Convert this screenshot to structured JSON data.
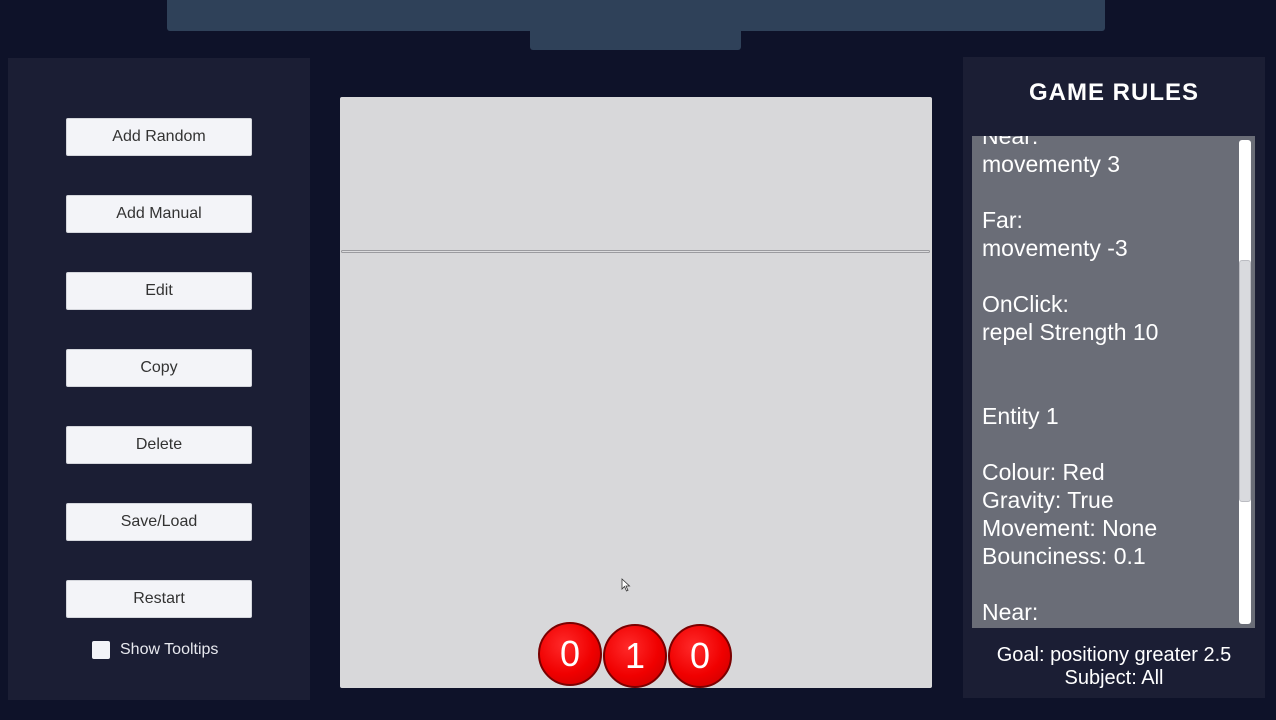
{
  "sidebar": {
    "buttons": [
      {
        "label": "Add Random"
      },
      {
        "label": "Add Manual"
      },
      {
        "label": "Edit"
      },
      {
        "label": "Copy"
      },
      {
        "label": "Delete"
      },
      {
        "label": "Save/Load"
      },
      {
        "label": "Restart"
      }
    ],
    "show_tooltips_label": "Show Tooltips",
    "show_tooltips_checked": false
  },
  "game": {
    "entities": [
      {
        "label": "0",
        "color": "#f00000"
      },
      {
        "label": "1",
        "color": "#f00000"
      },
      {
        "label": "0",
        "color": "#f00000"
      }
    ]
  },
  "rules": {
    "title": "GAME RULES",
    "text": "Near:\nmovementy 3\n\nFar:\nmovementy -3\n\nOnClick:\nrepel Strength 10\n\n\nEntity 1\n\nColour: Red\nGravity: True\nMovement: None\nBounciness: 0.1\n\nNear:",
    "goal": "Goal: positiony greater 2.5",
    "subject": "Subject: All"
  },
  "colors": {
    "background": "#0e1229",
    "panel": "#1b1e34",
    "canvas": "#d8d8da",
    "entity_red": "#f00000"
  }
}
